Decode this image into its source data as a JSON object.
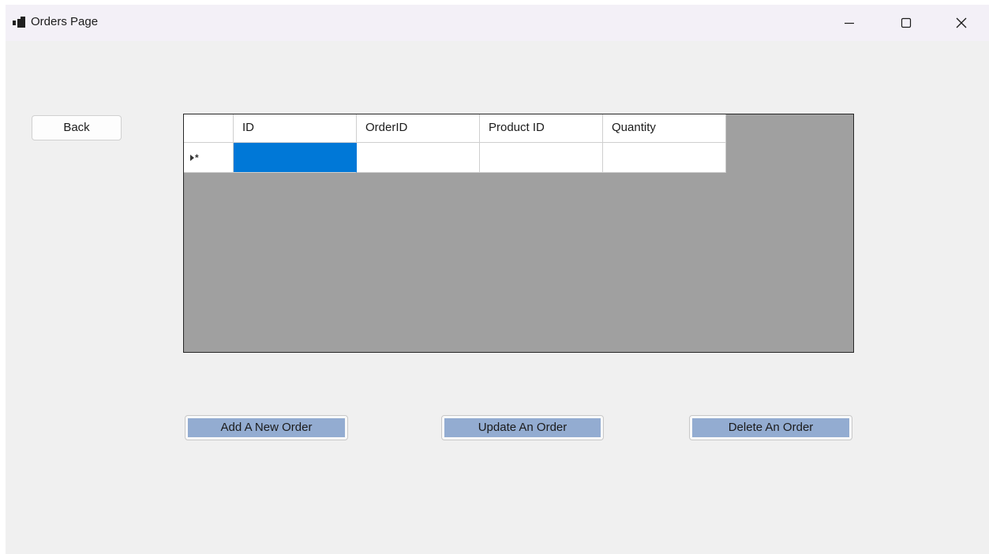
{
  "window": {
    "title": "Orders Page",
    "icons": {
      "app": "app-window-icon",
      "minimize": "minimize-icon",
      "maximize": "maximize-icon",
      "close": "close-icon"
    }
  },
  "buttons": {
    "back": "Back",
    "add": "Add A New Order",
    "update": "Update An Order",
    "delete": "Delete An Order"
  },
  "grid": {
    "columns": [
      "ID",
      "OrderID",
      "Product ID",
      "Quantity"
    ],
    "rows": [
      {
        "indicator": "*",
        "cells": [
          "",
          "",
          "",
          ""
        ],
        "selected_column": 0
      }
    ]
  },
  "colors": {
    "selection": "#0078d7",
    "grid_background": "#a0a0a0",
    "action_button_face": "#93acd1",
    "form_background": "#f0f0f0"
  }
}
